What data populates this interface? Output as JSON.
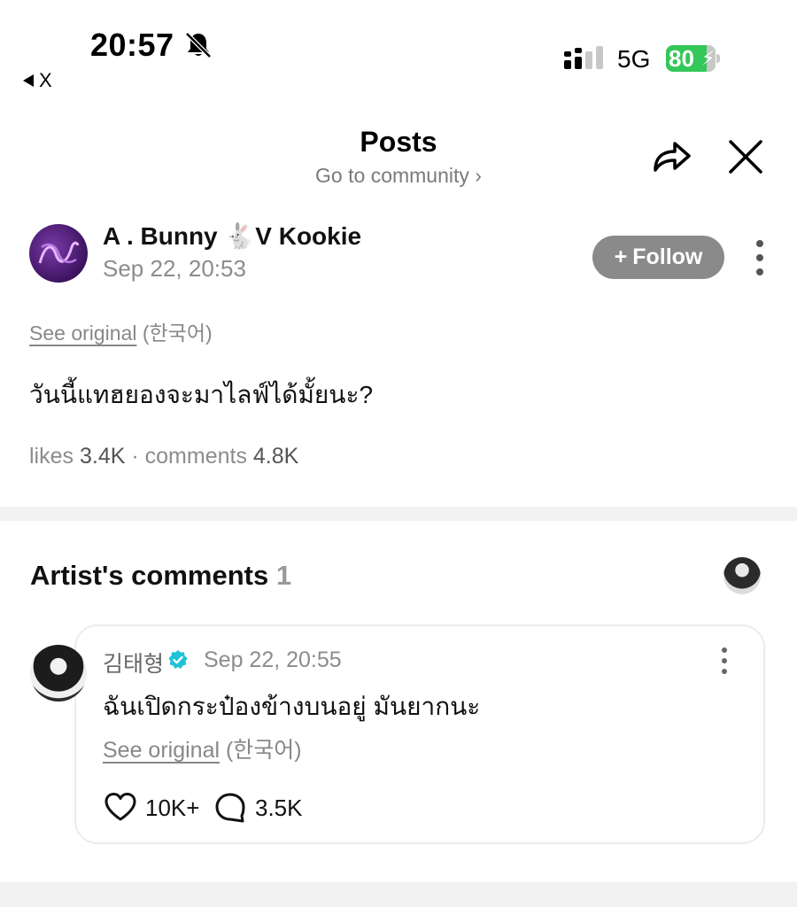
{
  "status_bar": {
    "time": "20:57",
    "back_label": "X",
    "network": "5G",
    "battery": "80"
  },
  "header": {
    "title": "Posts",
    "subtitle": "Go to community ›"
  },
  "post": {
    "author": "A . Bunny 🐇V Kookie",
    "time": "Sep 22, 20:53",
    "follow_label": "Follow",
    "see_original": "See original",
    "language": "(한국어)",
    "body": "วันนี้แทฮยองจะมาไลฟ์ได้มั้ยนะ?",
    "likes_label": "likes",
    "likes_value": "3.4K",
    "separator": "·",
    "comments_label": "comments",
    "comments_value": "4.8K"
  },
  "artist_comments": {
    "title": "Artist's comments",
    "count": "1",
    "comment": {
      "name": "김태형",
      "time": "Sep 22, 20:55",
      "body": "ฉันเปิดกระป๋องข้างบนอยู่ มันยากนะ",
      "see_original": "See original",
      "language": "(한국어)",
      "likes": "10K+",
      "replies": "3.5K"
    }
  },
  "colors": {
    "battery_green": "#34c759",
    "follow_bg": "#8a8a8a",
    "verified": "#1fc2d6",
    "community_avatar": "#4b1a73"
  },
  "icons": [
    "bell-slash-icon",
    "signal-icon",
    "share-icon",
    "close-icon",
    "more-vertical-icon",
    "verified-icon",
    "heart-icon",
    "comment-bubble-icon"
  ]
}
